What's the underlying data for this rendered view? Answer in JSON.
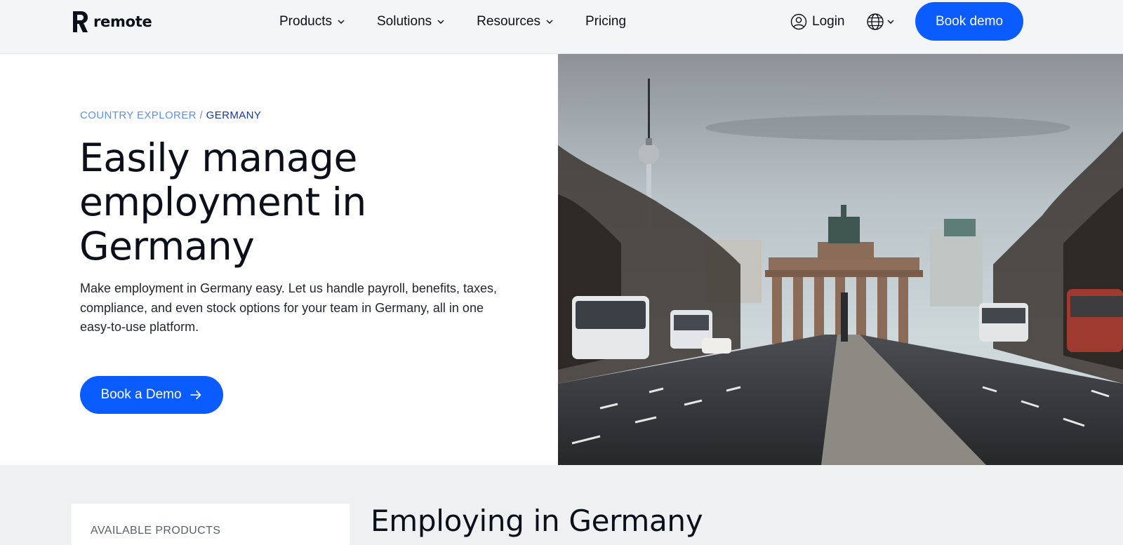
{
  "header": {
    "brand": "remote",
    "nav": [
      {
        "label": "Products",
        "has_dropdown": true
      },
      {
        "label": "Solutions",
        "has_dropdown": true
      },
      {
        "label": "Resources",
        "has_dropdown": true
      },
      {
        "label": "Pricing",
        "has_dropdown": false
      }
    ],
    "login_label": "Login",
    "book_demo_label": "Book demo"
  },
  "hero": {
    "breadcrumb_root": "COUNTRY EXPLORER",
    "breadcrumb_sep": "/",
    "breadcrumb_current": "GERMANY",
    "title": "Easily manage employment in Germany",
    "description": "Make employment in Germany easy. Let us handle payroll, benefits, taxes, compliance, and even stock options for your team in Germany, all in one easy-to-use platform.",
    "cta_label": "Book a Demo"
  },
  "lower": {
    "products_label": "AVAILABLE PRODUCTS",
    "section_title": "Employing in Germany"
  },
  "colors": {
    "accent": "#0a5cff",
    "breadcrumb_light": "#5b8ff5",
    "breadcrumb_dark": "#1237b5",
    "lower_bg": "#eef0f2"
  },
  "icons": [
    "remote-logo-icon",
    "chevron-down-icon",
    "user-icon",
    "globe-icon",
    "arrow-right-icon"
  ]
}
